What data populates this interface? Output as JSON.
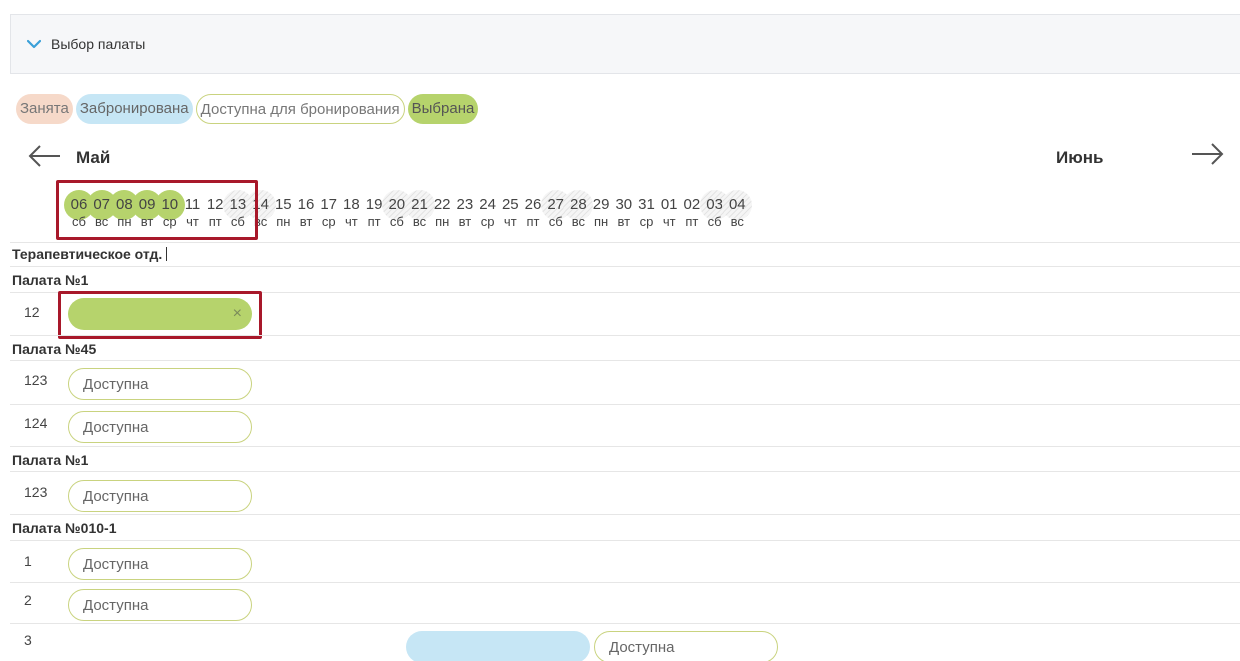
{
  "panel": {
    "title": "Выбор палаты"
  },
  "legend": {
    "occupied": "Занята",
    "reserved": "Забронирована",
    "available": "Доступна для бронирования",
    "selected": "Выбрана"
  },
  "calendar": {
    "month_left": "Май",
    "month_right": "Июнь",
    "days": [
      {
        "num": "06",
        "dow": "сб",
        "state": "selected"
      },
      {
        "num": "07",
        "dow": "вс",
        "state": "selected"
      },
      {
        "num": "08",
        "dow": "пн",
        "state": "selected"
      },
      {
        "num": "09",
        "dow": "вт",
        "state": "selected"
      },
      {
        "num": "10",
        "dow": "ср",
        "state": "selected"
      },
      {
        "num": "11",
        "dow": "чт",
        "state": "normal"
      },
      {
        "num": "12",
        "dow": "пт",
        "state": "normal"
      },
      {
        "num": "13",
        "dow": "сб",
        "state": "weekend"
      },
      {
        "num": "14",
        "dow": "вс",
        "state": "weekend"
      },
      {
        "num": "15",
        "dow": "пн",
        "state": "normal"
      },
      {
        "num": "16",
        "dow": "вт",
        "state": "normal"
      },
      {
        "num": "17",
        "dow": "ср",
        "state": "normal"
      },
      {
        "num": "18",
        "dow": "чт",
        "state": "normal"
      },
      {
        "num": "19",
        "dow": "пт",
        "state": "normal"
      },
      {
        "num": "20",
        "dow": "сб",
        "state": "weekend"
      },
      {
        "num": "21",
        "dow": "вс",
        "state": "weekend"
      },
      {
        "num": "22",
        "dow": "пн",
        "state": "normal"
      },
      {
        "num": "23",
        "dow": "вт",
        "state": "normal"
      },
      {
        "num": "24",
        "dow": "ср",
        "state": "normal"
      },
      {
        "num": "25",
        "dow": "чт",
        "state": "normal"
      },
      {
        "num": "26",
        "dow": "пт",
        "state": "normal"
      },
      {
        "num": "27",
        "dow": "сб",
        "state": "weekend"
      },
      {
        "num": "28",
        "dow": "вс",
        "state": "weekend"
      },
      {
        "num": "29",
        "dow": "пн",
        "state": "normal"
      },
      {
        "num": "30",
        "dow": "вт",
        "state": "normal"
      },
      {
        "num": "31",
        "dow": "ср",
        "state": "normal"
      },
      {
        "num": "01",
        "dow": "чт",
        "state": "normal"
      },
      {
        "num": "02",
        "dow": "пт",
        "state": "normal"
      },
      {
        "num": "03",
        "dow": "сб",
        "state": "weekend"
      },
      {
        "num": "04",
        "dow": "вс",
        "state": "weekend"
      }
    ]
  },
  "department": {
    "name": "Терапевтическое отд."
  },
  "groups": [
    {
      "title": "Палата №1"
    },
    {
      "title": "Палата №45"
    },
    {
      "title": "Палата №1"
    },
    {
      "title": "Палата №010-1"
    }
  ],
  "beds": [
    {
      "num": "12",
      "status": "selected",
      "label": ""
    },
    {
      "num": "123",
      "status": "available",
      "label": "Доступна"
    },
    {
      "num": "124",
      "status": "available",
      "label": "Доступна"
    },
    {
      "num": "123",
      "status": "available",
      "label": "Доступна"
    },
    {
      "num": "1",
      "status": "available",
      "label": "Доступна"
    },
    {
      "num": "2",
      "status": "available",
      "label": "Доступна"
    },
    {
      "num": "3",
      "status": "mixed",
      "label": "Доступна"
    }
  ],
  "colors": {
    "selected": "#b6d36c",
    "reserved": "#c6e6f5",
    "occupied": "#f6d9c9",
    "available_border": "#c9d37f",
    "highlight": "#a8182a"
  }
}
